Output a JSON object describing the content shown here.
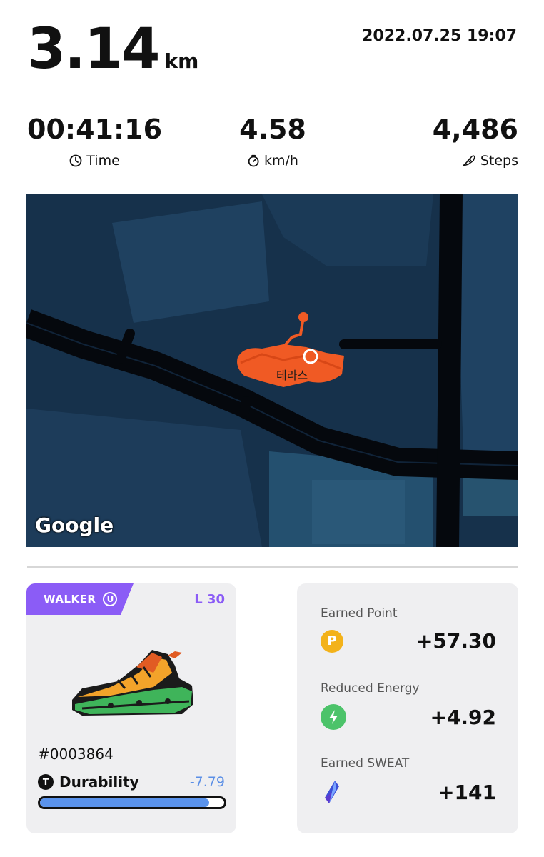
{
  "summary": {
    "distance_value": "3.14",
    "distance_unit": "km",
    "datetime": "2022.07.25 19:07"
  },
  "stats": {
    "time_value": "00:41:16",
    "time_label": "Time",
    "speed_value": "4.58",
    "speed_label": "km/h",
    "steps_value": "4,486",
    "steps_label": "Steps"
  },
  "map": {
    "place_label": "테라스",
    "logo": "Google"
  },
  "sneaker": {
    "type": "WALKER",
    "badge": "U",
    "level": "L 30",
    "id": "#0003864",
    "durability_label": "Durability",
    "durability_badge": "T",
    "durability_change": "-7.79",
    "durability_fraction": 0.92
  },
  "rewards": {
    "point_label": "Earned Point",
    "point_icon": "P",
    "point_value": "+57.30",
    "energy_label": "Reduced Energy",
    "energy_value": "+4.92",
    "sweat_label": "Earned SWEAT",
    "sweat_value": "+141"
  },
  "colors": {
    "accent_purple": "#8b5cf6",
    "route_orange": "#f05a24",
    "map_background": "#16314b",
    "durability_blue": "#5a93ec"
  }
}
